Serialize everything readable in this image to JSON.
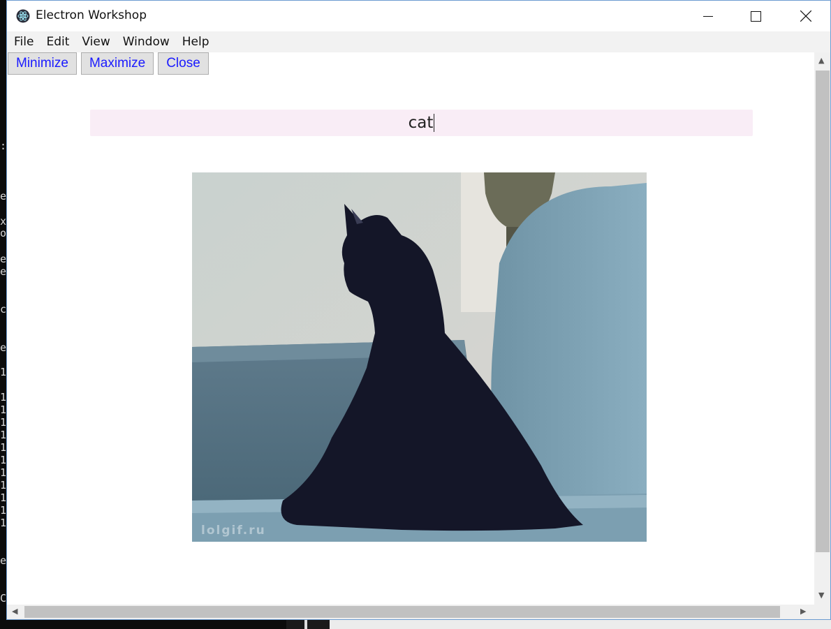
{
  "window": {
    "title": "Electron Workshop",
    "icon": "electron-atom-icon",
    "controls": [
      "minimize-icon",
      "maximize-icon",
      "close-icon"
    ]
  },
  "menu": {
    "items": [
      "File",
      "Edit",
      "View",
      "Window",
      "Help"
    ]
  },
  "toolbar": {
    "minimize_label": "Minimize",
    "maximize_label": "Maximize",
    "close_label": "Close"
  },
  "search": {
    "value": "cat"
  },
  "gif": {
    "watermark": "lolgif.ru"
  },
  "background_terminal": [
    "er",
    "x",
    "oc",
    "er",
    "er",
    "cu",
    "e",
    ":",
    "1",
    "1",
    "1",
    "1",
    "1",
    "1",
    "1",
    "1",
    "1",
    "1",
    "1",
    "1",
    "er",
    "C:"
  ],
  "colors": {
    "button_text": "#1a1aff",
    "search_bg": "#f9edf6",
    "window_border": "#6b9bd1"
  }
}
